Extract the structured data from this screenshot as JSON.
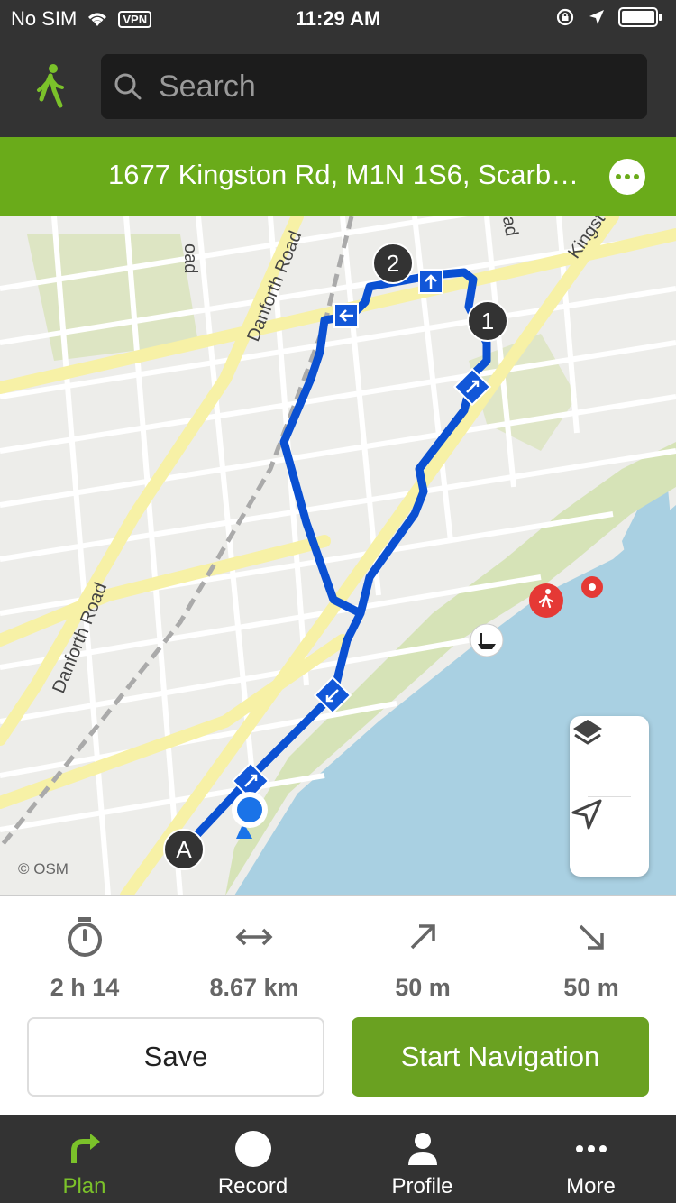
{
  "status_bar": {
    "carrier": "No SIM",
    "vpn": "VPN",
    "time": "11:29 AM"
  },
  "header": {
    "activity_icon": "walking-person-icon",
    "search_placeholder": "Search"
  },
  "address_bar": {
    "address": "1677 Kingston Rd, M1N 1S6, Scarb…",
    "menu_icon": "more-horizontal-icon"
  },
  "map": {
    "credit": "© OSM",
    "street_labels": [
      "Danforth Road",
      "Danforth Road",
      "oad",
      "oad",
      "Kingst"
    ],
    "waypoints": [
      "A",
      "1",
      "2"
    ],
    "route_color": "#0a50d2",
    "water_color": "#a9d0e2"
  },
  "stats": [
    {
      "icon": "stopwatch-icon",
      "value": "2 h 14"
    },
    {
      "icon": "distance-arrows-icon",
      "value": "8.67 km"
    },
    {
      "icon": "ascent-arrow-icon",
      "value": "50 m"
    },
    {
      "icon": "descent-arrow-icon",
      "value": "50 m"
    }
  ],
  "actions": {
    "save_label": "Save",
    "start_label": "Start Navigation"
  },
  "tabs": [
    {
      "label": "Plan",
      "icon": "turn-arrow-icon",
      "active": true
    },
    {
      "label": "Record",
      "icon": "record-circle-icon",
      "active": false
    },
    {
      "label": "Profile",
      "icon": "person-icon",
      "active": false
    },
    {
      "label": "More",
      "icon": "more-dots-icon",
      "active": false
    }
  ],
  "colors": {
    "accent_green": "#6aab1a",
    "dark_bar": "#333333",
    "active_tab": "#7bc22a"
  }
}
